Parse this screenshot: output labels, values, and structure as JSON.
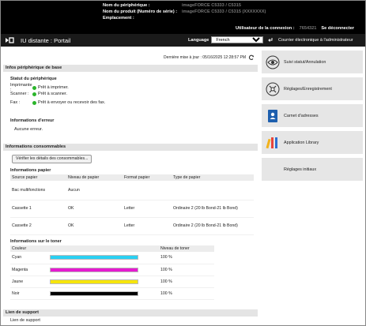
{
  "device": {
    "name_label": "Nom du périphérique :",
    "name_value": "imageFORCE C5333 / C5315",
    "product_label": "Nom du produit (Numéro de série) :",
    "product_value": "imageFORCE C5333 / C5315 (XXXXXXX)",
    "location_label": "Emplacement :"
  },
  "login": {
    "label": "Utilisateur de la connexion :",
    "user": "7654321",
    "logout": "Se déconnecter"
  },
  "titlebar": {
    "title": "IU distante : Portail",
    "language_label": "Language",
    "language_value": "French",
    "mail_admin": "Courrier électronique à l'administrateur"
  },
  "updated": "Dernière mise à jour : 05/16/2025 12:28:57 PM",
  "basic": {
    "header": "Infos périphérique de base",
    "status_title": "Statut du périphérique",
    "rows": [
      {
        "label": "Imprimante :",
        "value": "Prêt à imprimer."
      },
      {
        "label": "Scanner :",
        "value": "Prêt à scanner."
      },
      {
        "label": "Fax :",
        "value": "Prêt à envoyer ou recevoir des fax."
      }
    ],
    "error_title": "Informations d'erreur",
    "error_value": "Aucune erreur."
  },
  "consumables": {
    "header": "Informations consommables",
    "check_button": "Vérifier les détails des consommables...",
    "paper_title": "Informations papier",
    "paper_columns": [
      "Source papier",
      "Niveau de papier",
      "Format papier",
      "Type de papier"
    ],
    "paper_rows": [
      {
        "source": "Bac multifonctions",
        "level": "Aucun",
        "format": "",
        "type": ""
      },
      {
        "source": "Cassette 1",
        "level": "OK",
        "format": "Letter",
        "type": "Ordinaire 2 (20 lb Bond-21 lb Bond)"
      },
      {
        "source": "Cassette 2",
        "level": "OK",
        "format": "Letter",
        "type": "Ordinaire 2 (20 lb Bond-21 lb Bond)"
      }
    ],
    "toner_title": "Informations sur le toner",
    "toner_columns": [
      "Couleur",
      "",
      "Niveau de toner"
    ],
    "toner_rows": [
      {
        "color": "Cyan",
        "level": "100 %",
        "fill": 1.0,
        "hex": "#2ad0f2"
      },
      {
        "color": "Magenta",
        "level": "100 %",
        "fill": 1.0,
        "hex": "#e51bd0"
      },
      {
        "color": "Jaune",
        "level": "100 %",
        "fill": 1.0,
        "hex": "#f6e50c"
      },
      {
        "color": "Noir",
        "level": "100 %",
        "fill": 1.0,
        "hex": "#000000"
      }
    ]
  },
  "support": {
    "header": "Lien de support",
    "link": "Lien de support"
  },
  "side": [
    {
      "label": "Suivi statut/Annulation",
      "icon": "status-monitor-icon"
    },
    {
      "label": "Réglages/Enregistrement",
      "icon": "settings-icon"
    },
    {
      "label": "Carnet d'adresses",
      "icon": "address-book-icon"
    },
    {
      "label": "Application Library",
      "icon": "application-library-icon"
    },
    {
      "label": "Réglages initiaux",
      "icon": ""
    }
  ]
}
